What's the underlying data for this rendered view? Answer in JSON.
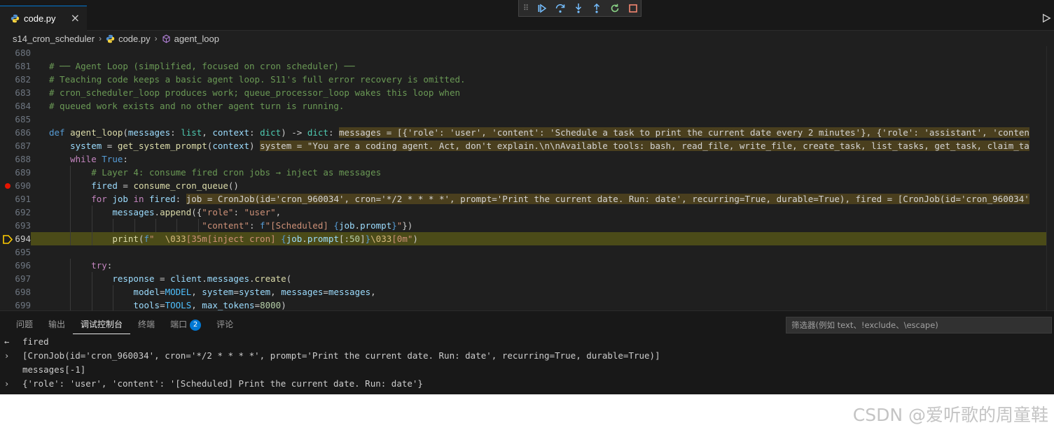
{
  "tab": {
    "label": "code.py",
    "close": "×",
    "icon": "python-file-icon"
  },
  "debug_toolbar": [
    "continue-icon",
    "step-over-icon",
    "step-into-icon",
    "step-out-icon",
    "restart-icon",
    "stop-icon"
  ],
  "breadcrumb": {
    "folder": "s14_cron_scheduler",
    "file": "code.py",
    "symbol": "agent_loop"
  },
  "code_lines": [
    {
      "n": "680",
      "t": ""
    },
    {
      "n": "681",
      "t": "# ── Agent Loop (simplified, focused on cron scheduler) ──"
    },
    {
      "n": "682",
      "t": "# Teaching code keeps a basic agent loop. S11's full error recovery is omitted."
    },
    {
      "n": "683",
      "t": "# cron_scheduler_loop produces work; queue_processor_loop wakes this loop when"
    },
    {
      "n": "684",
      "t": "# queued work exists and no other agent turn is running."
    },
    {
      "n": "685",
      "t": ""
    },
    {
      "n": "686",
      "sig": "def agent_loop(messages: list, context: dict) -> dict:",
      "inline": "messages = [{'role': 'user', 'content': 'Schedule a task to print the current date every 2 minutes'}, {'role': 'assistant', 'conten"
    },
    {
      "n": "687",
      "t": "    system = get_system_prompt(context)",
      "inline": "system = \"You are a coding agent. Act, don't explain.\\n\\nAvailable tools: bash, read_file, write_file, create_task, list_tasks, get_task, claim_ta"
    },
    {
      "n": "688",
      "t": "    while True:"
    },
    {
      "n": "689",
      "t": "        # Layer 4: consume fired cron jobs → inject as messages"
    },
    {
      "n": "690",
      "t": "        fired = consume_cron_queue()"
    },
    {
      "n": "691",
      "t": "        for job in fired:",
      "inline": "job = CronJob(id='cron_960034', cron='*/2 * * * *', prompt='Print the current date. Run: date', recurring=True, durable=True), fired = [CronJob(id='cron_960034'"
    },
    {
      "n": "692",
      "t": "            messages.append({\"role\": \"user\","
    },
    {
      "n": "693",
      "t": "                             \"content\": f\"[Scheduled] {job.prompt}\"})"
    },
    {
      "n": "694",
      "t": "            print(f\"  \\033[35m[inject cron] {job.prompt[:50]}\\033[0m\")"
    },
    {
      "n": "695",
      "t": ""
    },
    {
      "n": "696",
      "t": "        try:"
    },
    {
      "n": "697",
      "t": "            response = client.messages.create("
    },
    {
      "n": "698",
      "t": "                model=MODEL, system=system, messages=messages,"
    },
    {
      "n": "699",
      "t": "                tools=TOOLS, max_tokens=8000)"
    }
  ],
  "panel": {
    "tabs": [
      {
        "label": "问题"
      },
      {
        "label": "输出"
      },
      {
        "label": "调试控制台"
      },
      {
        "label": "终端"
      },
      {
        "label": "端口",
        "badge": "2"
      },
      {
        "label": "评论"
      }
    ],
    "filter_placeholder": "筛选器(例如 text、!exclude、\\escape)",
    "console": [
      {
        "glyph": "←",
        "text": "fired"
      },
      {
        "glyph": "›",
        "text": "[CronJob(id='cron_960034', cron='*/2 * * * *', prompt='Print the current date. Run: date', recurring=True, durable=True)]"
      },
      {
        "glyph": "",
        "text": "messages[-1]"
      },
      {
        "glyph": "›",
        "text": "{'role': 'user', 'content': '[Scheduled] Print the current date. Run: date'}"
      }
    ]
  },
  "watermark": "CSDN @爱听歌的周童鞋"
}
